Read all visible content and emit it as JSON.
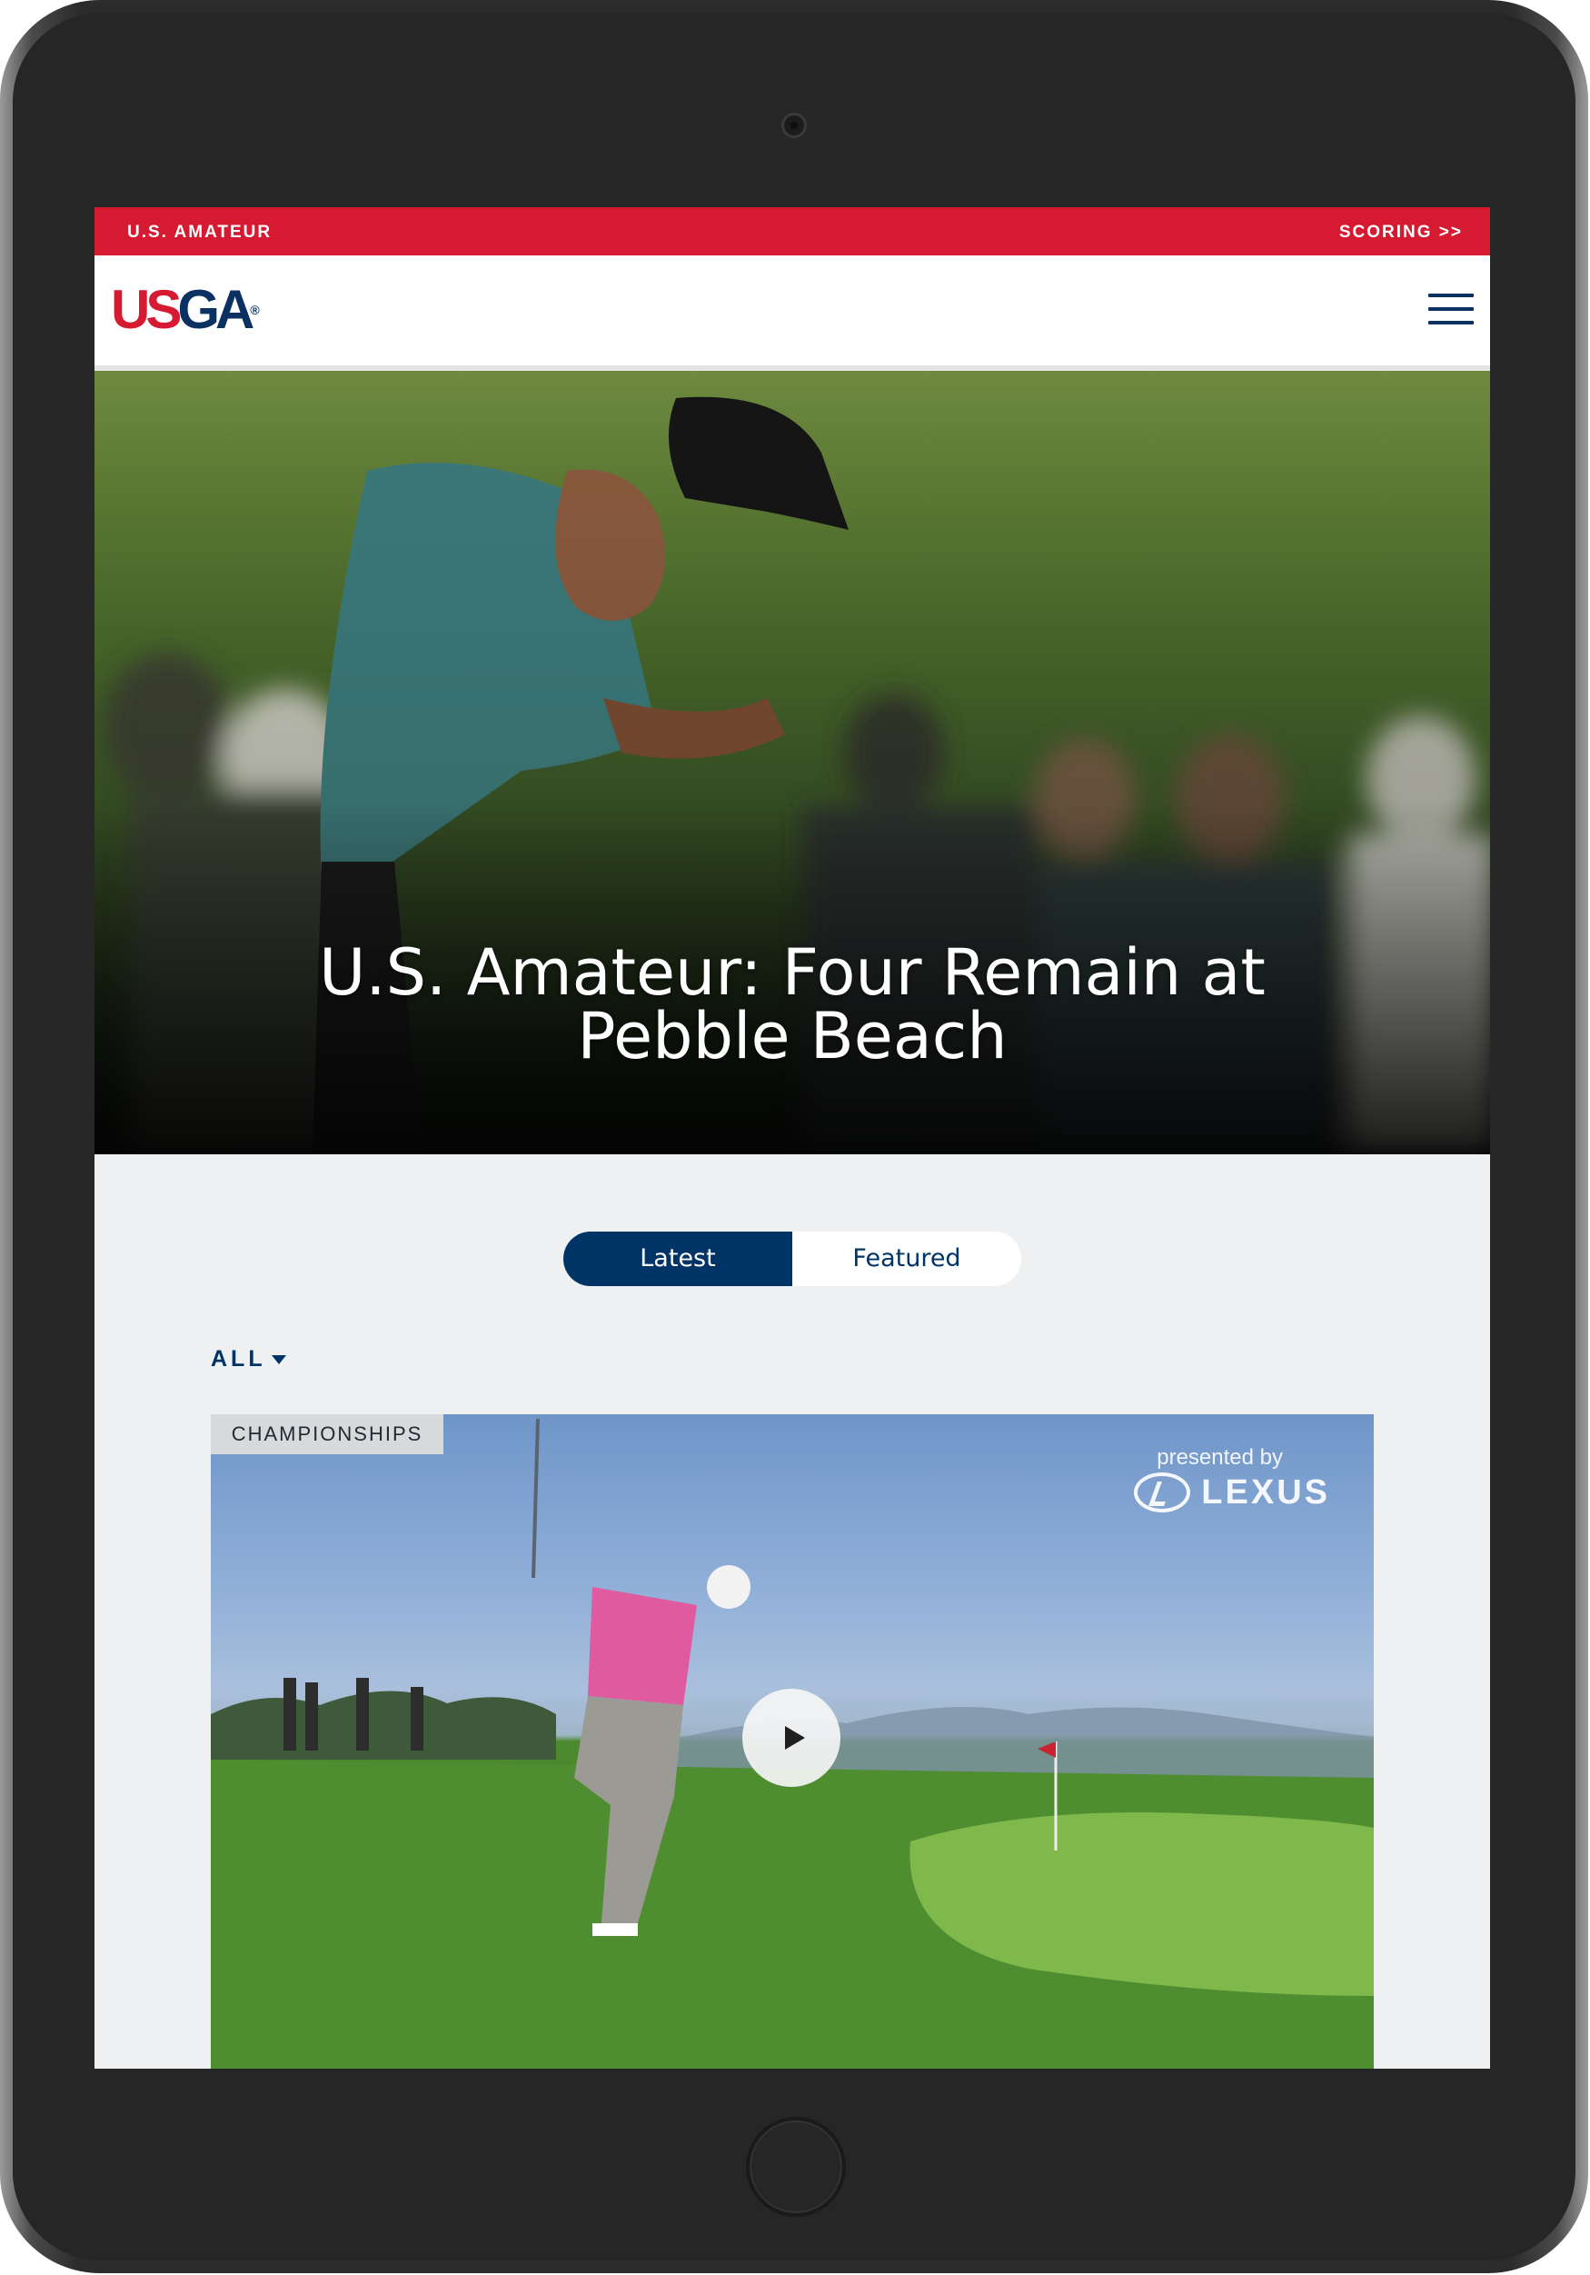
{
  "topbar": {
    "section_label": "U.S. AMATEUR",
    "scoring_label": "SCORING >>"
  },
  "header": {
    "logo_us": "US",
    "logo_ga": "GA",
    "logo_reg": "®",
    "menu_icon": "hamburger-icon"
  },
  "hero": {
    "title_line1": "U.S. Amateur: Four Remain at",
    "title_line2": "Pebble Beach"
  },
  "tabs": {
    "latest": "Latest",
    "featured": "Featured",
    "active": "Latest"
  },
  "filter": {
    "label": "ALL"
  },
  "card": {
    "category": "CHAMPIONSHIPS",
    "sponsor_prefix": "presented by",
    "sponsor_name": "LEXUS",
    "play_icon": "play-icon"
  },
  "colors": {
    "brand_red": "#d51a32",
    "brand_navy": "#003366",
    "page_bg": "#eef0f2"
  }
}
